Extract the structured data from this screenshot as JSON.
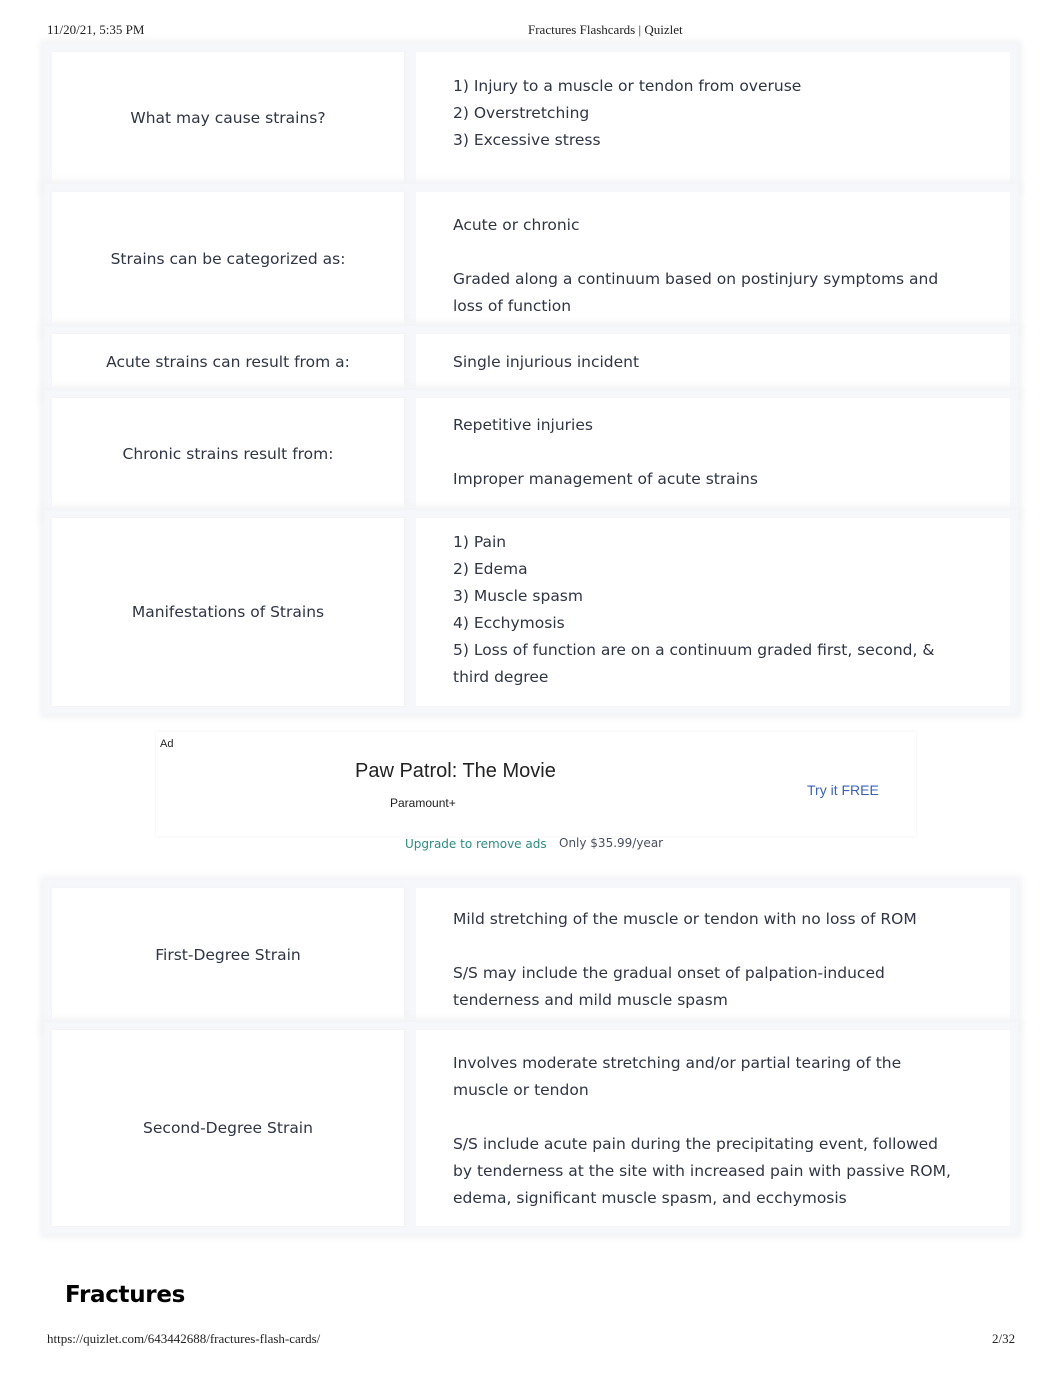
{
  "print_header": {
    "datetime": "11/20/21, 5:35 PM",
    "title": "Fractures Flashcards | Quizlet"
  },
  "cards": [
    {
      "term": "What may cause strains?",
      "definition": [
        "1) Injury to a muscle or tendon from overuse",
        "2) Overstretching",
        "3) Excessive stress"
      ]
    },
    {
      "term": "Strains can be categorized as:",
      "definition": [
        "Acute or chronic",
        "",
        "Graded along a continuum based on postinjury symptoms and loss of function"
      ]
    },
    {
      "term": "Acute strains can result from a:",
      "definition": [
        "Single injurious incident"
      ]
    },
    {
      "term": "Chronic strains result from:",
      "definition": [
        "Repetitive injuries",
        "",
        "Improper management of acute strains"
      ]
    },
    {
      "term": "Manifestations of Strains",
      "definition": [
        "1) Pain",
        "2) Edema",
        "3) Muscle spasm",
        "4) Ecchymosis",
        "5) Loss of function are on a continuum graded first, second, & third degree"
      ]
    },
    {
      "term": "First-Degree Strain",
      "definition": [
        "Mild stretching of the muscle or tendon with no loss of ROM",
        "",
        "S/S may include the gradual onset of palpation-induced tenderness and mild muscle spasm"
      ]
    },
    {
      "term": "Second-Degree Strain",
      "definition": [
        "Involves moderate stretching and/or partial tearing of the muscle or tendon",
        "",
        "S/S include acute pain during the precipitating event, followed by tenderness at the site with increased pain with passive ROM, edema, significant muscle spasm, and ecchymosis"
      ]
    }
  ],
  "ad": {
    "label": "Ad",
    "title": "Paw Patrol: The Movie",
    "advertiser": "Paramount+",
    "cta": "Try it FREE",
    "upgrade_link": "Upgrade to remove ads",
    "price": "Only $35.99/year"
  },
  "section_heading": "Fractures",
  "print_footer": {
    "url": "https://quizlet.com/643442688/fractures-flash-cards/",
    "page": "2/32"
  },
  "colors": {
    "upgrade_link": "#2e8b80",
    "cta_link": "#3a63b8"
  }
}
